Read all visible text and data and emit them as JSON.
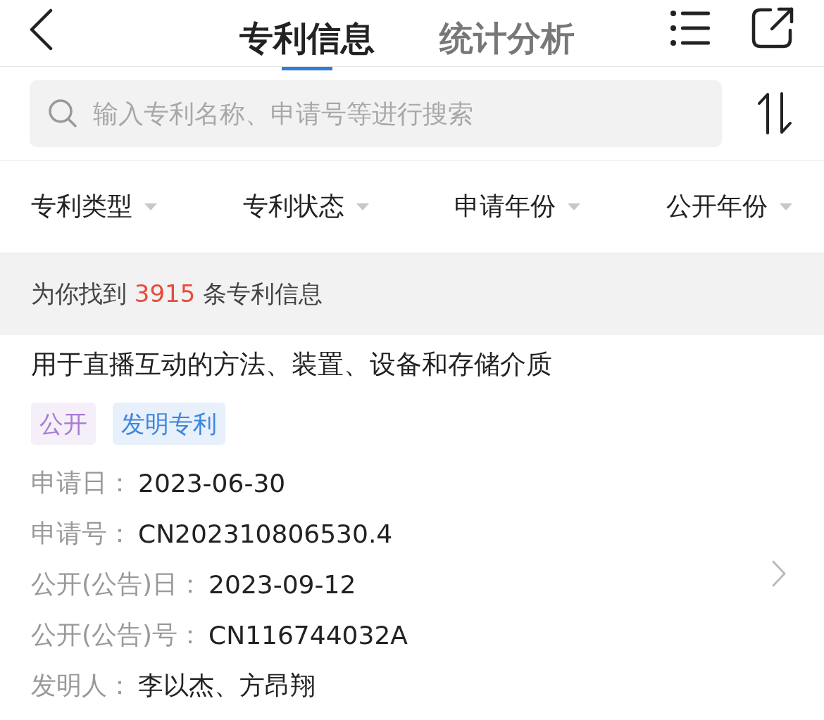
{
  "header": {
    "tabs": [
      {
        "label": "专利信息",
        "selected": true
      },
      {
        "label": "统计分析",
        "selected": false
      }
    ]
  },
  "search": {
    "placeholder": "输入专利名称、申请号等进行搜索"
  },
  "filters": [
    {
      "label": "专利类型"
    },
    {
      "label": "专利状态"
    },
    {
      "label": "申请年份"
    },
    {
      "label": "公开年份"
    }
  ],
  "summary": {
    "prefix": "为你找到",
    "count": "3915",
    "suffix": "条专利信息"
  },
  "patents": [
    {
      "title": "用于直播互动的方法、装置、设备和存储介质",
      "tags": [
        {
          "label": "公开",
          "color": "#a77bd0"
        },
        {
          "label": "发明专利",
          "color": "#3a86e0"
        }
      ],
      "fields": [
        {
          "label": "申请日：",
          "value": "2023-06-30"
        },
        {
          "label": "申请号：",
          "value": "CN202310806530.4"
        },
        {
          "label": "公开(公告)日：",
          "value": "2023-09-12"
        },
        {
          "label": "公开(公告)号：",
          "value": "CN116744032A"
        },
        {
          "label": "发明人：",
          "value": "李以杰、方昂翔"
        }
      ]
    }
  ]
}
